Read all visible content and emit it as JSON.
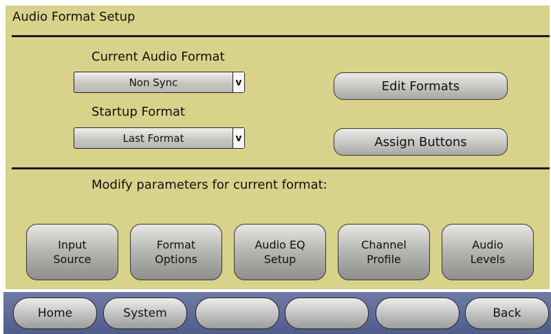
{
  "header": {
    "title": "Audio Format Setup"
  },
  "current_format": {
    "label": "Current Audio Format",
    "value": "Non Sync",
    "arrow": "v"
  },
  "startup_format": {
    "label": "Startup Format",
    "value": "Last Format",
    "arrow": "v"
  },
  "actions": {
    "edit_formats": "Edit Formats",
    "assign_buttons": "Assign Buttons"
  },
  "modify_label": "Modify parameters for current format:",
  "params": [
    {
      "label": "Input\nSource"
    },
    {
      "label": "Format\nOptions"
    },
    {
      "label": "Audio EQ\nSetup"
    },
    {
      "label": "Channel\nProfile"
    },
    {
      "label": "Audio\nLevels"
    }
  ],
  "nav": {
    "home": "Home",
    "system": "System",
    "blank1": "",
    "blank2": "",
    "blank3": "",
    "back": "Back"
  },
  "colors": {
    "panel": "#d9d28a",
    "navbar": "#5e6996"
  }
}
